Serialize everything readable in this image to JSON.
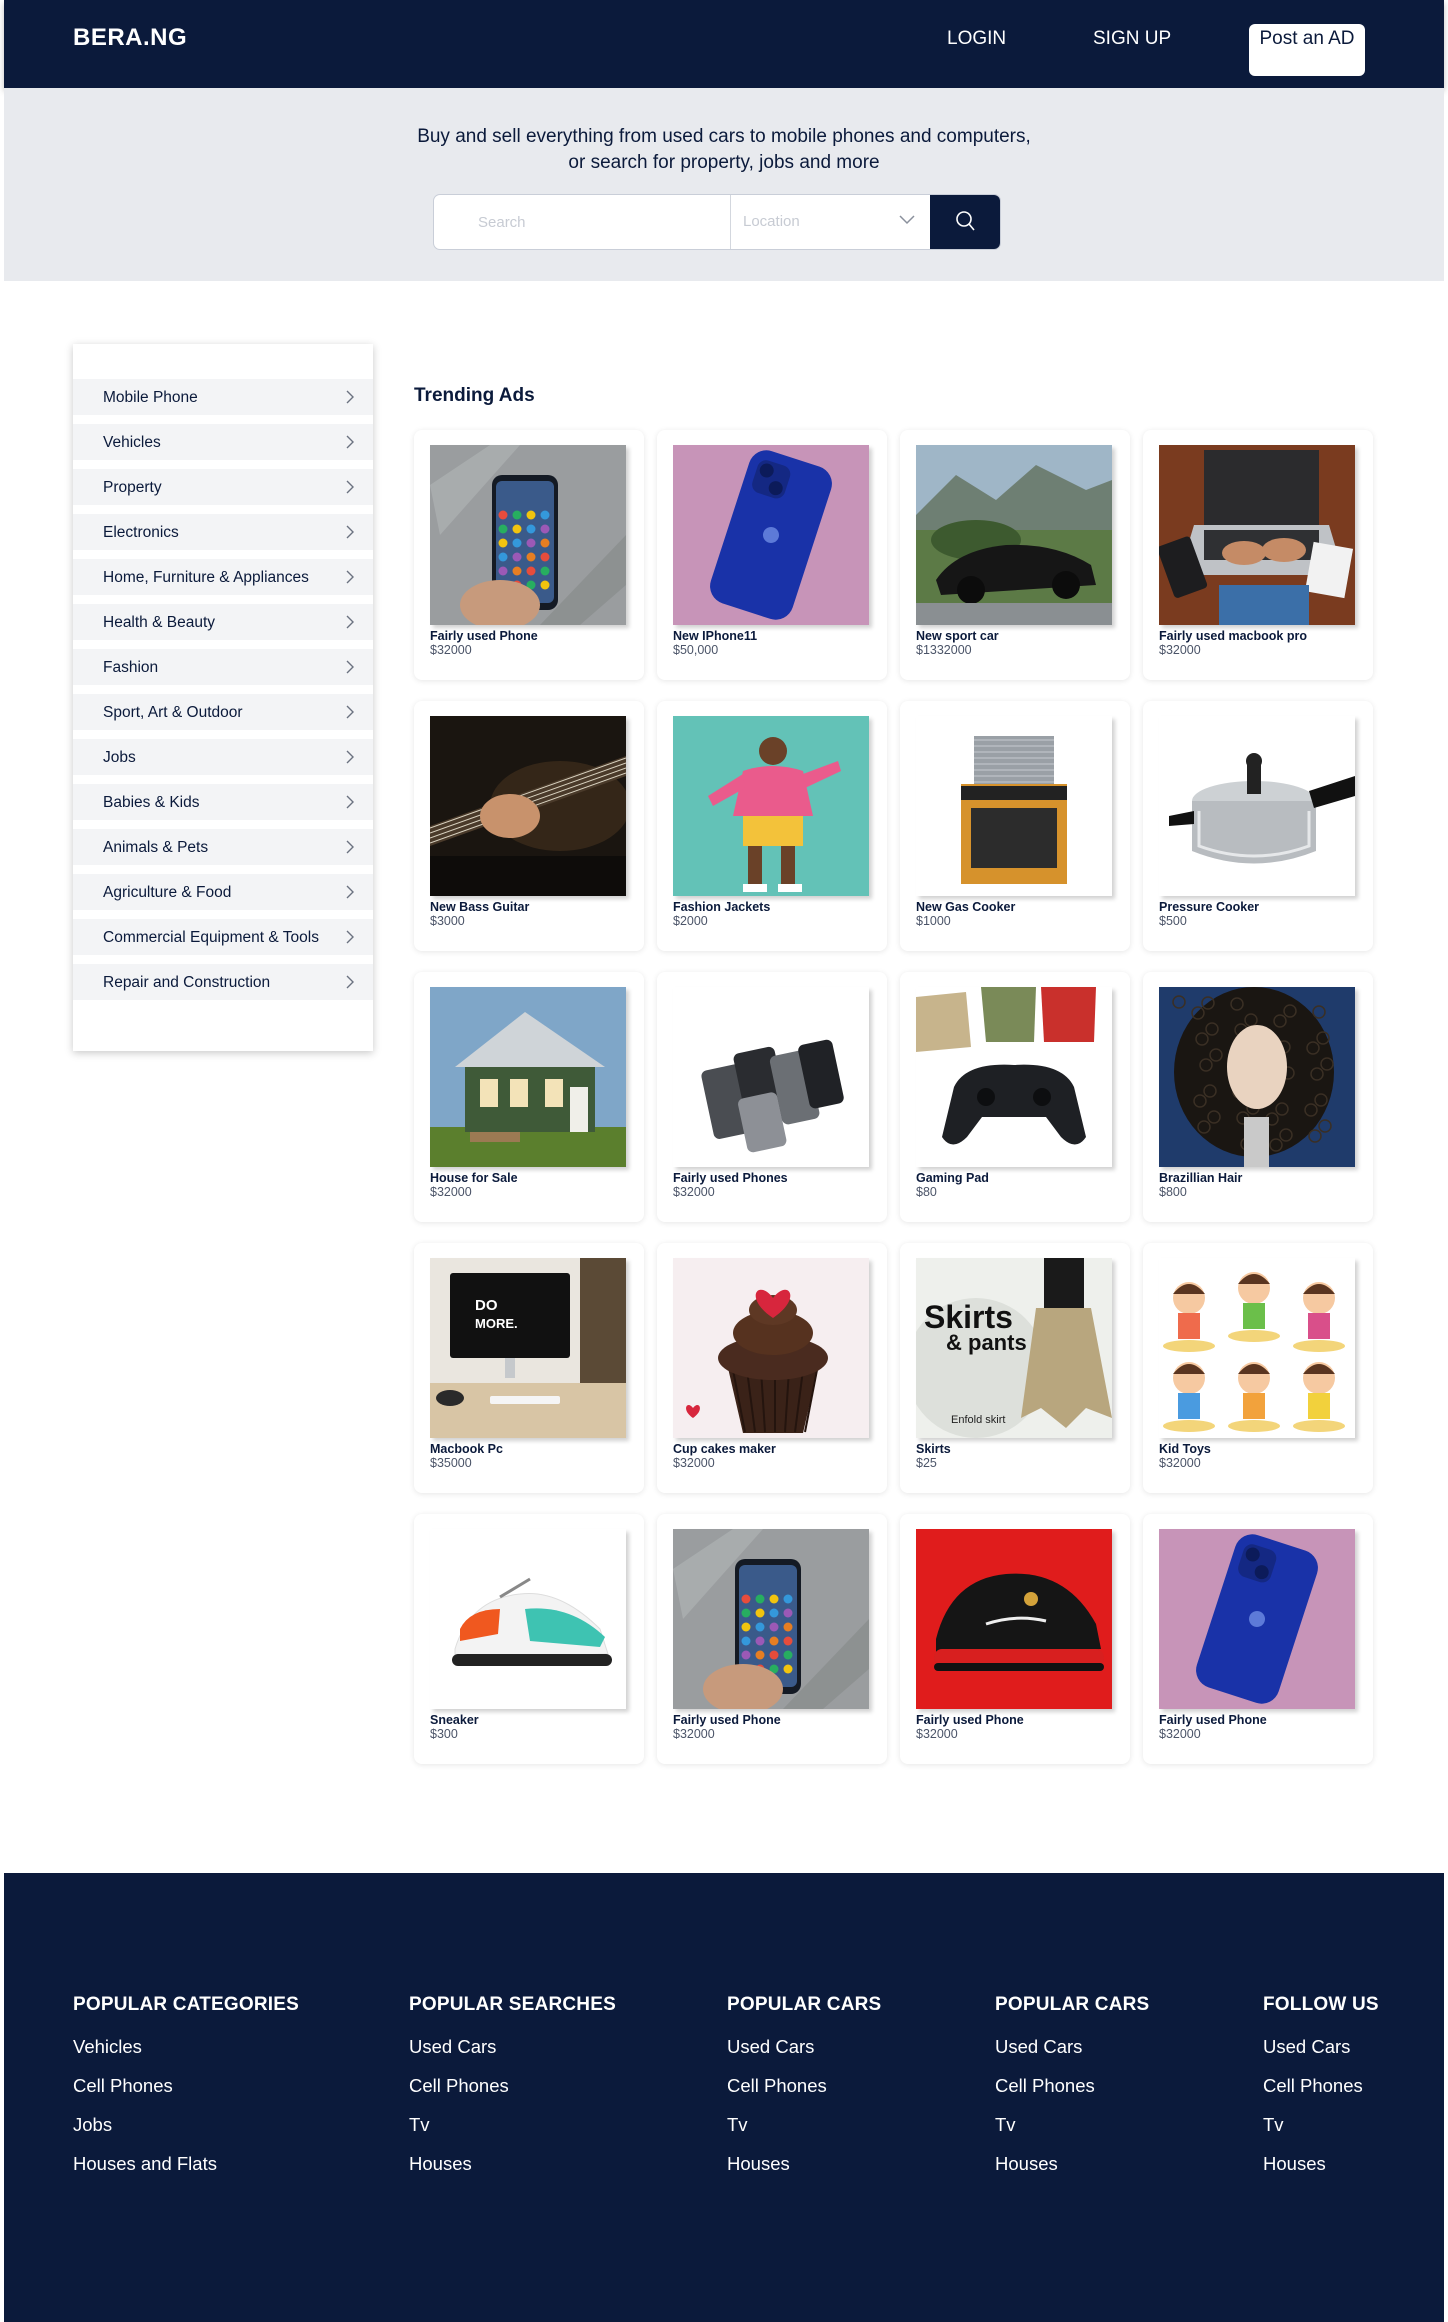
{
  "header": {
    "logo": "BERA.NG",
    "login": "LOGIN",
    "signup": "SIGN UP",
    "post_ad": "Post an AD"
  },
  "hero": {
    "line1": "Buy and sell everything from used cars to mobile phones and computers,",
    "line2": "or search for property, jobs and more",
    "search_placeholder": "Search",
    "location_placeholder": "Location"
  },
  "sidebar": {
    "items": [
      {
        "label": "Mobile Phone"
      },
      {
        "label": "Vehicles"
      },
      {
        "label": "Property"
      },
      {
        "label": "Electronics"
      },
      {
        "label": "Home, Furniture & Appliances"
      },
      {
        "label": "Health & Beauty"
      },
      {
        "label": "Fashion"
      },
      {
        "label": "Sport, Art & Outdoor"
      },
      {
        "label": "Jobs"
      },
      {
        "label": "Babies & Kids"
      },
      {
        "label": "Animals & Pets"
      },
      {
        "label": "Agriculture & Food"
      },
      {
        "label": "Commercial Equipment & Tools"
      },
      {
        "label": "Repair and Construction"
      }
    ]
  },
  "trending": {
    "title": "Trending Ads",
    "ads": [
      {
        "name": "Fairly used Phone",
        "price": "$32000"
      },
      {
        "name": "New IPhone11",
        "price": "$50,000"
      },
      {
        "name": "New sport car",
        "price": "$1332000"
      },
      {
        "name": "Fairly used macbook pro",
        "price": "$32000"
      },
      {
        "name": "New Bass Guitar",
        "price": "$3000"
      },
      {
        "name": "Fashion Jackets",
        "price": "$2000"
      },
      {
        "name": "New Gas Cooker",
        "price": "$1000"
      },
      {
        "name": "Pressure Cooker",
        "price": "$500"
      },
      {
        "name": "House for Sale",
        "price": "$32000"
      },
      {
        "name": "Fairly used Phones",
        "price": "$32000"
      },
      {
        "name": "Gaming Pad",
        "price": "$80"
      },
      {
        "name": "Brazillian Hair",
        "price": "$800"
      },
      {
        "name": "Macbook Pc",
        "price": "$35000"
      },
      {
        "name": "Cup cakes maker",
        "price": "$32000"
      },
      {
        "name": "Skirts",
        "price": "$25"
      },
      {
        "name": "Kid Toys",
        "price": "$32000"
      },
      {
        "name": "Sneaker",
        "price": "$300"
      },
      {
        "name": "Fairly used Phone",
        "price": "$32000"
      },
      {
        "name": "Fairly used Phone",
        "price": "$32000"
      },
      {
        "name": "Fairly used Phone",
        "price": "$32000"
      }
    ],
    "image_text": {
      "do_more": "DO MORE.",
      "skirts": "Skirts",
      "pants": "& pants",
      "enfold": "Enfold skirt"
    }
  },
  "footer": {
    "columns": [
      {
        "heading": "POPULAR CATEGORIES",
        "links": [
          "Vehicles",
          "Cell Phones",
          "Jobs",
          "Houses and Flats"
        ]
      },
      {
        "heading": "POPULAR SEARCHES",
        "links": [
          "Used Cars",
          "Cell Phones",
          "Tv",
          "Houses"
        ]
      },
      {
        "heading": "POPULAR CARS",
        "links": [
          "Used Cars",
          "Cell Phones",
          "Tv",
          "Houses"
        ]
      },
      {
        "heading": "POPULAR CARS",
        "links": [
          "Used Cars",
          "Cell Phones",
          "Tv",
          "Houses"
        ]
      },
      {
        "heading": "FOLLOW US",
        "links": [
          "Used Cars",
          "Cell Phones",
          "Tv",
          "Houses"
        ]
      }
    ]
  },
  "colors": {
    "navy": "#0b1a3b",
    "hero_bg": "#e8eaee",
    "sidebar_item_bg": "#f3f4f6"
  }
}
